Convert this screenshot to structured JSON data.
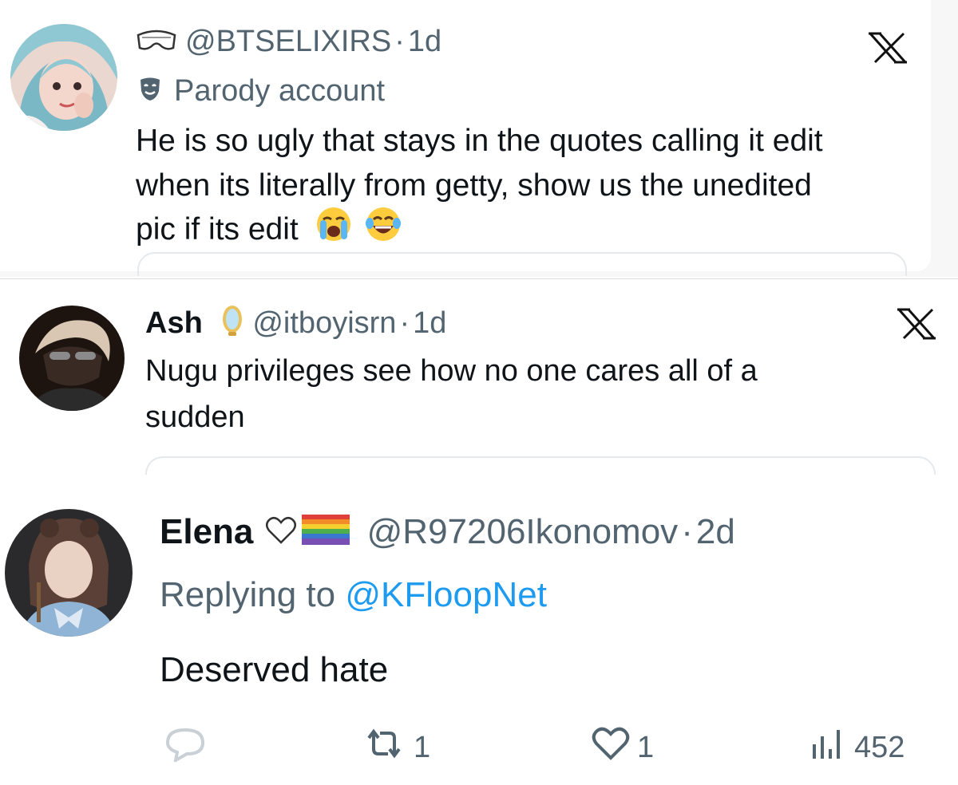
{
  "tweets": [
    {
      "handle": "@BTSELIXIRS",
      "time": "1d",
      "label_icon": "mask-icon",
      "label_text": "Parody account",
      "text_lines": [
        "He is so ugly that stays in the quotes calling it edit",
        "when its literally from getty, show us the unedited",
        "pic if its edit"
      ],
      "emojis": [
        "loudly-crying-face",
        "face-with-tears-of-joy"
      ]
    },
    {
      "name": "Ash",
      "badge_icon": "mirror-icon",
      "handle": "@itboyisrn",
      "time": "1d",
      "text_lines": [
        "Nugu privileges see how no one cares all of a",
        "sudden"
      ]
    },
    {
      "name": "Elena",
      "badges": [
        "white-heart-icon",
        "rainbow-flag-icon"
      ],
      "handle": "@R97206Ikonomov",
      "time": "2d",
      "reply_prefix": "Replying to",
      "reply_to": "@KFloopNet",
      "text": "Deserved hate",
      "actions": {
        "retweets": "1",
        "likes": "1",
        "views": "452"
      }
    }
  ],
  "separator": "·",
  "colors": {
    "text": "#0f1419",
    "muted": "#536471",
    "link": "#1d9bf0"
  }
}
